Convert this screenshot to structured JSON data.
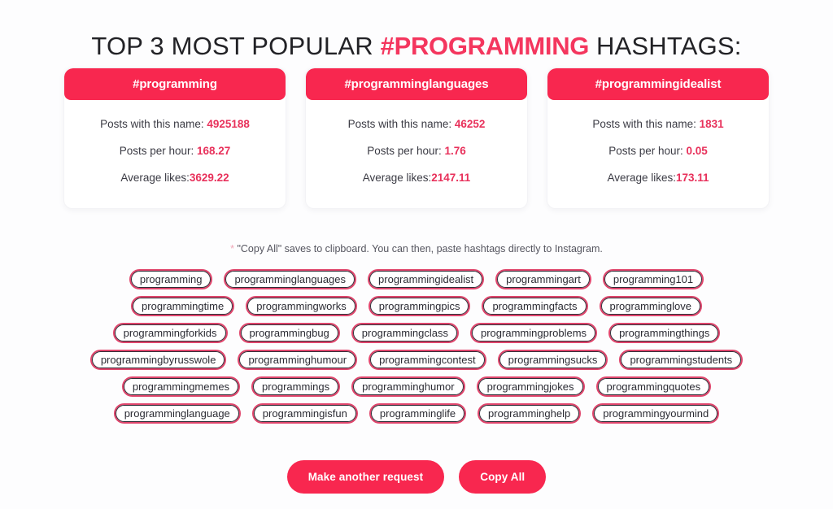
{
  "page": {
    "title_prefix": "TOP 3 MOST POPULAR ",
    "title_highlight": "#PROGRAMMING",
    "title_suffix": " HASHTAGS:",
    "accent_color": "#f8274f",
    "value_color": "#e8315b",
    "tag_border_color": "#e0456c"
  },
  "cards": [
    {
      "name": "#programming",
      "posts_label": "Posts with this name: ",
      "posts_value": "4925188",
      "per_hour_label": "Posts per hour: ",
      "per_hour_value": "168.27",
      "avg_likes_label": "Average likes:",
      "avg_likes_value": "3629.22"
    },
    {
      "name": "#programminglanguages",
      "posts_label": "Posts with this name: ",
      "posts_value": "46252",
      "per_hour_label": "Posts per hour: ",
      "per_hour_value": "1.76",
      "avg_likes_label": "Average likes:",
      "avg_likes_value": "2147.11"
    },
    {
      "name": "#programmingidealist",
      "posts_label": "Posts with this name: ",
      "posts_value": "1831",
      "per_hour_label": "Posts per hour: ",
      "per_hour_value": "0.05",
      "avg_likes_label": "Average likes:",
      "avg_likes_value": "173.11"
    }
  ],
  "note": {
    "star": "* ",
    "text": "\"Copy All\" saves to clipboard. You can then, paste hashtags directly to Instagram."
  },
  "hashtag_rows": [
    [
      "programming",
      "programminglanguages",
      "programmingidealist",
      "programmingart",
      "programming101"
    ],
    [
      "programmingtime",
      "programmingworks",
      "programmingpics",
      "programmingfacts",
      "programminglove"
    ],
    [
      "programmingforkids",
      "programmingbug",
      "programmingclass",
      "programmingproblems",
      "programmingthings"
    ],
    [
      "programmingbyrusswole",
      "programminghumour",
      "programmingcontest",
      "programmingsucks",
      "programmingstudents"
    ],
    [
      "programmingmemes",
      "programmings",
      "programminghumor",
      "programmingjokes",
      "programmingquotes"
    ],
    [
      "programminglanguage",
      "programmingisfun",
      "programminglife",
      "programminghelp",
      "programmingyourmind"
    ]
  ],
  "buttons": {
    "make_request": "Make another request",
    "copy_all": "Copy All"
  }
}
